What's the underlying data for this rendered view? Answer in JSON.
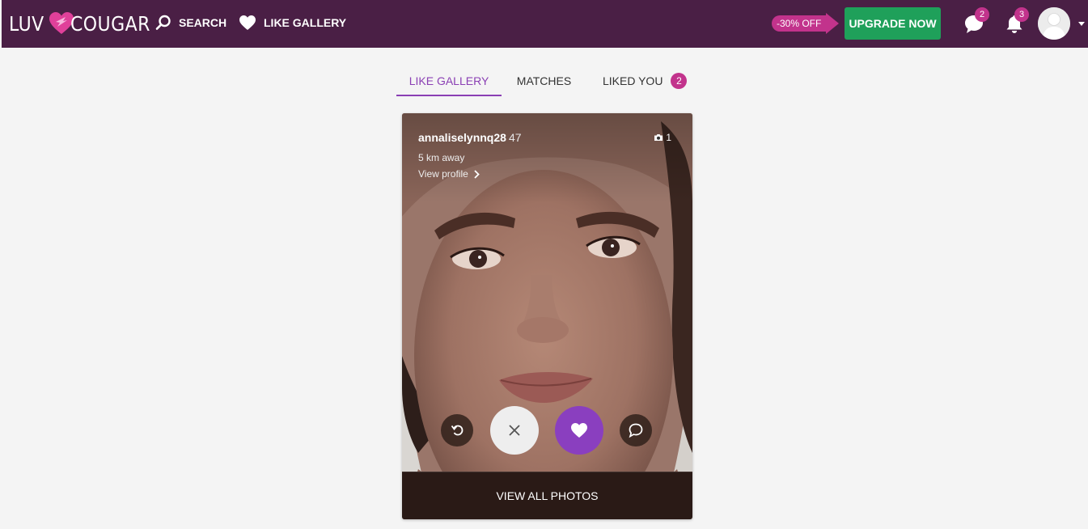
{
  "brand": {
    "logo_part1": "LUV",
    "logo_part2": "COUGAR"
  },
  "nav": {
    "search_label": "SEARCH",
    "like_gallery_label": "LIKE GALLERY"
  },
  "promo": {
    "discount_label": "-30% OFF",
    "upgrade_label": "UPGRADE NOW"
  },
  "notifications": {
    "messages_count": "2",
    "alerts_count": "3"
  },
  "tabs": [
    {
      "label": "LIKE GALLERY",
      "active": true
    },
    {
      "label": "MATCHES",
      "active": false
    },
    {
      "label": "LIKED YOU",
      "badge": "2",
      "active": false
    }
  ],
  "profile_card": {
    "username": "annaliselynnq28",
    "age": "47",
    "distance": "5 km away",
    "view_profile_label": "View profile",
    "photo_count": "1",
    "view_all_photos_label": "VIEW ALL PHOTOS"
  },
  "icons": {
    "search": "search-icon",
    "heart": "heart-icon",
    "chat": "chat-bubble-icon",
    "bell": "bell-icon",
    "camera": "camera-icon",
    "undo": "undo-icon",
    "close": "close-icon",
    "like": "heart-icon",
    "message": "chat-bubble-icon",
    "chevron": "chevron-right-icon",
    "caret": "caret-down-icon"
  },
  "colors": {
    "topbar": "#4a1f45",
    "accent_purple": "#8a3fb4",
    "badge_pink": "#c2338c",
    "upgrade_green": "#1fa05a"
  }
}
